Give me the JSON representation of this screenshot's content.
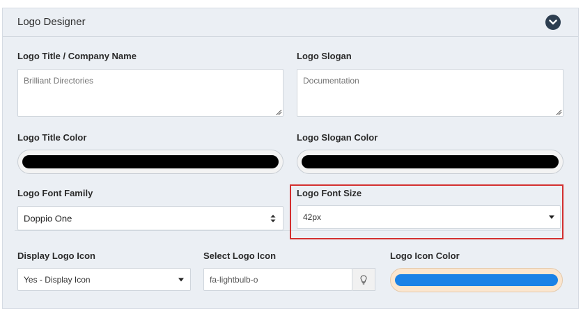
{
  "panel": {
    "title": "Logo Designer"
  },
  "fields": {
    "logo_title": {
      "label": "Logo Title / Company Name",
      "placeholder": "Brilliant Directories"
    },
    "logo_slogan": {
      "label": "Logo Slogan",
      "placeholder": "Documentation"
    },
    "logo_title_color": {
      "label": "Logo Title Color",
      "color": "#000000"
    },
    "logo_slogan_color": {
      "label": "Logo Slogan Color",
      "color": "#000000"
    },
    "logo_font_family": {
      "label": "Logo Font Family",
      "value": "Doppio One"
    },
    "logo_font_size": {
      "label": "Logo Font Size",
      "value": "42px"
    },
    "display_logo_icon": {
      "label": "Display Logo Icon",
      "value": "Yes - Display Icon"
    },
    "select_logo_icon": {
      "label": "Select Logo Icon",
      "value": "fa-lightbulb-o",
      "icon": "lightbulb-icon"
    },
    "logo_icon_color": {
      "label": "Logo Icon Color",
      "color": "#1b82e6"
    }
  },
  "colors": {
    "panel_bg": "#ebeff4",
    "highlight": "#d32f2f",
    "header_button": "#2d3e50"
  }
}
